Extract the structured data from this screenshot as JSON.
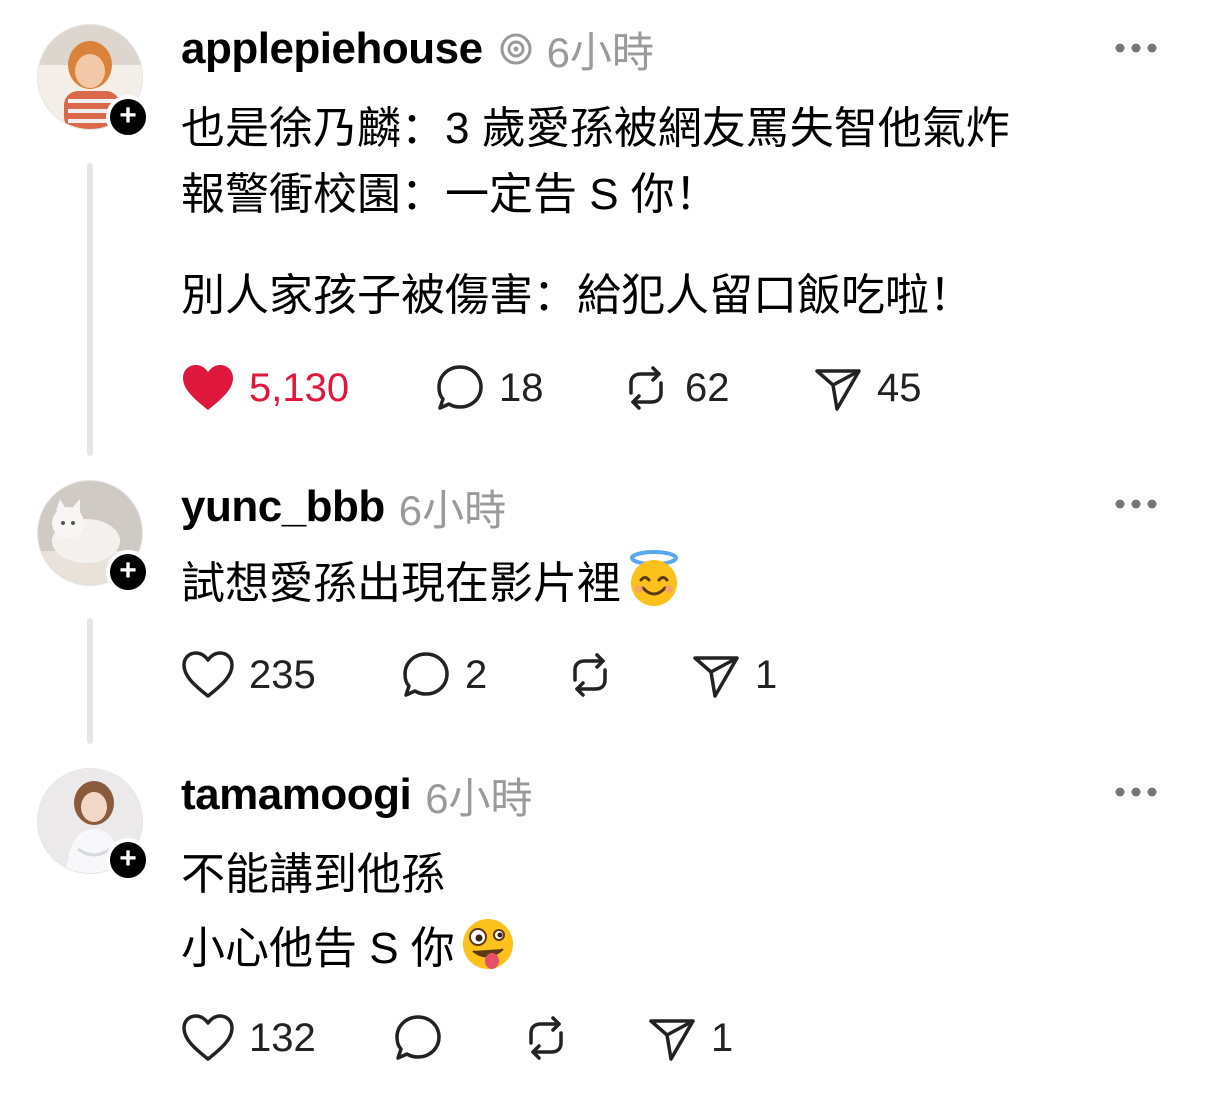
{
  "posts": [
    {
      "username": "applepiehouse",
      "time": "6小時",
      "verified": true,
      "text_lines": [
        "也是徐乃麟：3 歲愛孫被網友罵失智他氣炸",
        "報警衝校園：一定告 S 你！"
      ],
      "text_lines_2": [
        "別人家孩子被傷害：給犯人留口飯吃啦！"
      ],
      "likes": "5,130",
      "liked": true,
      "comments": "18",
      "reposts": "62",
      "shares": "45",
      "avatar_icon": "avatar-photo-woman-orange",
      "follow_icon": "plus-icon"
    },
    {
      "username": "yunc_bbb",
      "time": "6小時",
      "text_lines": [
        "試想愛孫出現在影片裡"
      ],
      "emoji": "smiling-face-with-halo",
      "likes": "235",
      "comments": "2",
      "reposts": "",
      "shares": "1",
      "avatar_icon": "avatar-photo-cat"
    },
    {
      "username": "tamamoogi",
      "time": "6小時",
      "text_lines": [
        "不能講到他孫",
        "小心他告 S 你"
      ],
      "emoji": "zany-face",
      "likes": "132",
      "comments": "",
      "reposts": "",
      "shares": "1",
      "avatar_icon": "avatar-photo-woman-white-dress"
    }
  ],
  "colors": {
    "like_active": "#e0173c",
    "time_gray": "#9a9a9a",
    "thread_line": "#e6e6e6"
  }
}
